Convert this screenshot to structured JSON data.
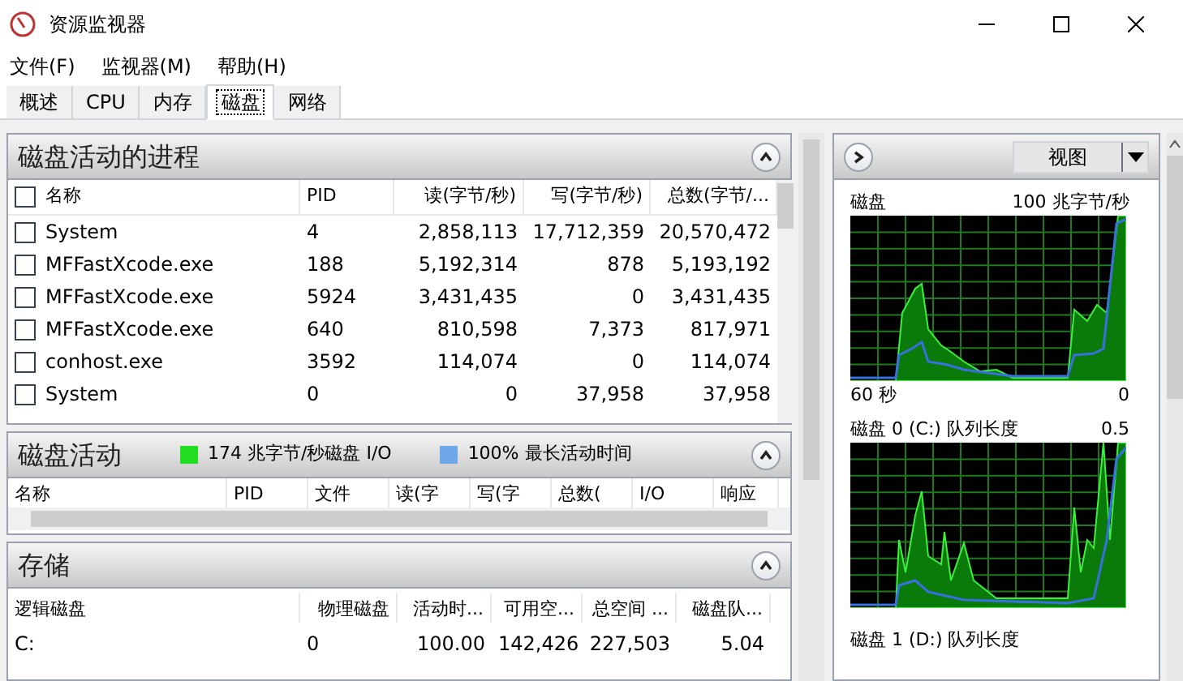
{
  "window": {
    "title": "资源监视器"
  },
  "menu": [
    "文件(F)",
    "监视器(M)",
    "帮助(H)"
  ],
  "tabs": [
    {
      "label": "概述",
      "selected": false
    },
    {
      "label": "CPU",
      "selected": false
    },
    {
      "label": "内存",
      "selected": false
    },
    {
      "label": "磁盘",
      "selected": true
    },
    {
      "label": "网络",
      "selected": false
    }
  ],
  "processes": {
    "title": "磁盘活动的进程",
    "header_checked": false,
    "columns": [
      "名称",
      "PID",
      "读(字节/秒)",
      "写(字节/秒)",
      "总数(字节/..."
    ],
    "rows": [
      {
        "checked": false,
        "cells": [
          "System",
          "4",
          "2,858,113",
          "17,712,359",
          "20,570,472"
        ]
      },
      {
        "checked": false,
        "cells": [
          "MFFastXcode.exe",
          "188",
          "5,192,314",
          "878",
          "5,193,192"
        ]
      },
      {
        "checked": false,
        "cells": [
          "MFFastXcode.exe",
          "5924",
          "3,431,435",
          "0",
          "3,431,435"
        ]
      },
      {
        "checked": false,
        "cells": [
          "MFFastXcode.exe",
          "640",
          "810,598",
          "7,373",
          "817,971"
        ]
      },
      {
        "checked": false,
        "cells": [
          "conhost.exe",
          "3592",
          "114,074",
          "0",
          "114,074"
        ]
      },
      {
        "checked": false,
        "cells": [
          "System",
          "0",
          "0",
          "37,958",
          "37,958"
        ]
      }
    ]
  },
  "disk_activity": {
    "title": "磁盘活动",
    "legend": [
      {
        "label": "174 兆字节/秒磁盘 I/O",
        "color": "#22dd22"
      },
      {
        "label": "100% 最长活动时间",
        "color": "#6fa8e8"
      }
    ],
    "columns": [
      "名称",
      "PID",
      "文件",
      "读(字",
      "写(字",
      "总数(",
      "I/O",
      "响应"
    ]
  },
  "storage": {
    "title": "存储",
    "columns": [
      "逻辑磁盘",
      "物理磁盘",
      "活动时...",
      "可用空...",
      "总空间 ...",
      "磁盘队..."
    ],
    "rows": [
      {
        "cells": [
          "C:",
          "0",
          "100.00",
          "142,426",
          "227,503",
          "5.04"
        ]
      }
    ]
  },
  "right_panel": {
    "view_button": "视图",
    "graphs": [
      {
        "label": "磁盘",
        "max": "100 兆字节/秒",
        "time": "60 秒",
        "min": "0"
      },
      {
        "label": "磁盘 0 (C:) 队列长度",
        "max": "0.5"
      }
    ],
    "next_label": "磁盘 1 (D:) 队列长度"
  }
}
